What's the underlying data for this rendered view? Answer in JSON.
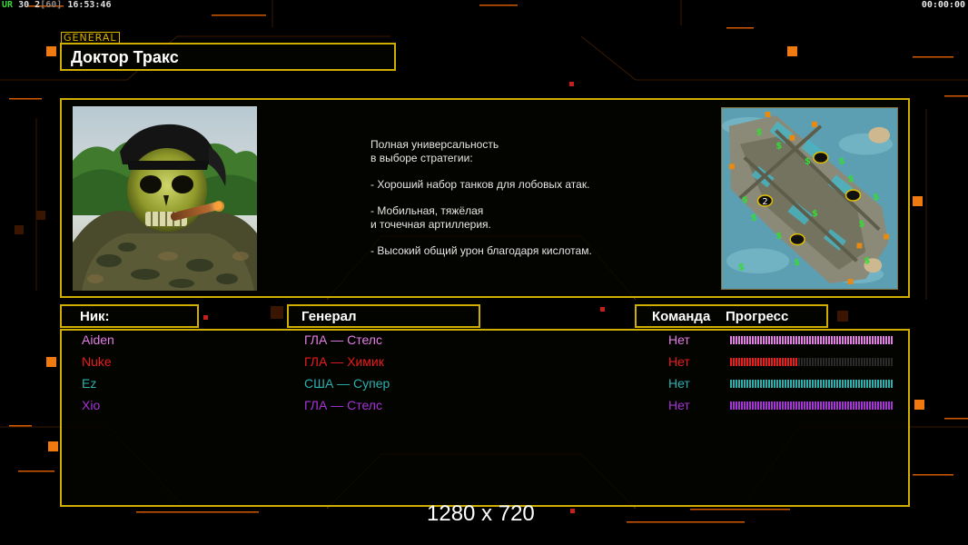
{
  "hud": {
    "version": "UR",
    "fps": "30",
    "fps_detail": "2",
    "fps_cap": "[60]",
    "clock": "16:53:46",
    "timer": "00:00:00"
  },
  "general_tag": "GENERAL",
  "general_name": "Доктор Тракс",
  "description": {
    "line1": "Полная универсальность",
    "line2": "в выборе стратегии:",
    "line3": "- Хороший набор танков для лобовых атак.",
    "line4": "- Мобильная, тяжёлая",
    "line5": "и точечная артиллерия.",
    "line6": "- Высокий общий урон благодаря кислотам."
  },
  "minimap": {
    "center_marker": "2"
  },
  "headers": {
    "nick": "Ник:",
    "general": "Генерал",
    "team": "Команда",
    "progress": "Прогресс"
  },
  "players": [
    {
      "nick": "Aiden",
      "general": "ГЛА — Стелс",
      "team": "Нет",
      "color": "#e27ee6",
      "progress": 1.0
    },
    {
      "nick": "Nuke",
      "general": "ГЛА — Химик",
      "team": "Нет",
      "color": "#ea1c1c",
      "progress": 0.42
    },
    {
      "nick": "Ez",
      "general": "США — Супер",
      "team": "Нет",
      "color": "#2bb0b0",
      "progress": 1.0
    },
    {
      "nick": "Xio",
      "general": "ГЛА — Стелс",
      "team": "Нет",
      "color": "#a634d8",
      "progress": 1.0
    }
  ],
  "resolution_text": "1280 x 720",
  "colors": {
    "frame": "#cfae00",
    "accent_orange": "#f07a10",
    "background": "#000000"
  }
}
